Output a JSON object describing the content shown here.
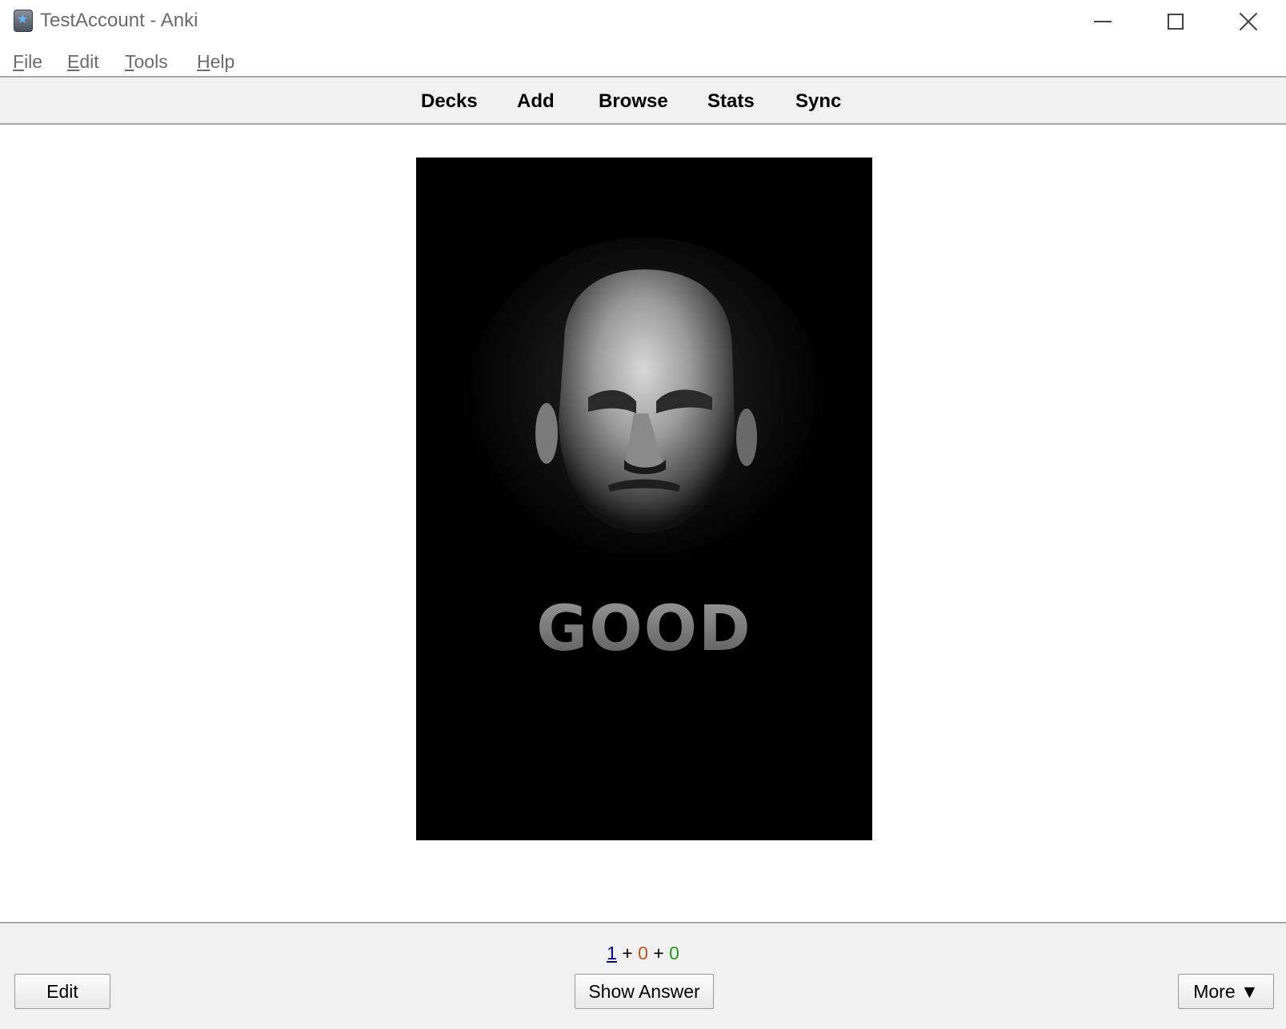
{
  "window": {
    "title": "TestAccount - Anki"
  },
  "menubar": {
    "items": [
      {
        "first": "F",
        "rest": "ile"
      },
      {
        "first": "E",
        "rest": "dit"
      },
      {
        "first": "T",
        "rest": "ools"
      },
      {
        "first": "H",
        "rest": "elp"
      }
    ]
  },
  "toolbar": {
    "decks": "Decks",
    "add": "Add",
    "browse": "Browse",
    "stats": "Stats",
    "sync": "Sync"
  },
  "card": {
    "image_text": "GOOD"
  },
  "counts": {
    "new": "1",
    "learn": "0",
    "review": "0",
    "sep": "+"
  },
  "buttons": {
    "edit": "Edit",
    "show_answer": "Show Answer",
    "more": "More ▼"
  },
  "colors": {
    "new": "#00008b",
    "learn": "#c35617",
    "review": "#1e9e1e"
  }
}
